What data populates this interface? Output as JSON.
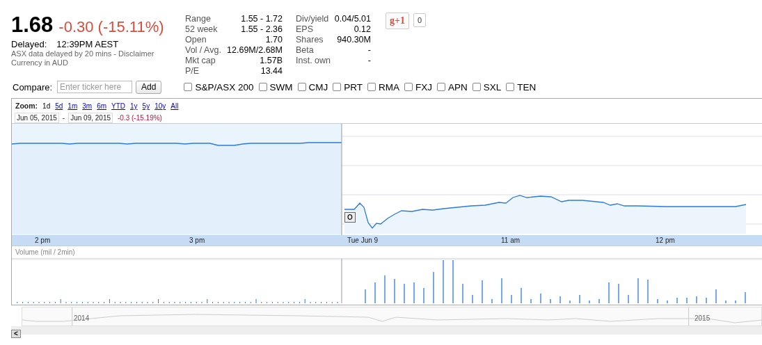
{
  "quote": {
    "price": "1.68",
    "change": "-0.30 (-15.11%)",
    "delayed_label": "Delayed:",
    "time": "12:39PM AEST",
    "notice": "ASX data delayed by 20 mins - Disclaimer",
    "currency": "Currency in AUD"
  },
  "stats": [
    [
      {
        "label": "Range",
        "value": "1.55 - 1.72"
      },
      {
        "label": "52 week",
        "value": "1.55 - 2.36"
      },
      {
        "label": "Open",
        "value": "1.70"
      },
      {
        "label": "Vol / Avg.",
        "value": "12.69M/2.68M"
      },
      {
        "label": "Mkt cap",
        "value": "1.57B"
      },
      {
        "label": "P/E",
        "value": "13.44"
      }
    ],
    [
      {
        "label": "Div/yield",
        "value": "0.04/5.01"
      },
      {
        "label": "EPS",
        "value": "0.12"
      },
      {
        "label": "Shares",
        "value": "940.30M"
      },
      {
        "label": "Beta",
        "value": "-"
      },
      {
        "label": "Inst. own",
        "value": "-"
      }
    ]
  ],
  "plusone": {
    "label": "g+1",
    "count": "0"
  },
  "compare": {
    "label": "Compare:",
    "placeholder": "Enter ticker here",
    "button": "Add",
    "tickers": [
      {
        "label": "S&P/ASX 200",
        "checked": false
      },
      {
        "label": "SWM",
        "checked": false
      },
      {
        "label": "CMJ",
        "checked": false
      },
      {
        "label": "PRT",
        "checked": false
      },
      {
        "label": "RMA",
        "checked": false
      },
      {
        "label": "FXJ",
        "checked": false
      },
      {
        "label": "APN",
        "checked": false
      },
      {
        "label": "SXL",
        "checked": false
      },
      {
        "label": "TEN",
        "checked": false
      }
    ]
  },
  "zoom": {
    "label": "Zoom:",
    "options": [
      {
        "label": "1d",
        "selected": true
      },
      {
        "label": "5d",
        "selected": false
      },
      {
        "label": "1m",
        "selected": false
      },
      {
        "label": "3m",
        "selected": false
      },
      {
        "label": "6m",
        "selected": false
      },
      {
        "label": "YTD",
        "selected": false
      },
      {
        "label": "1y",
        "selected": false
      },
      {
        "label": "5y",
        "selected": false
      },
      {
        "label": "10y",
        "selected": false
      },
      {
        "label": "All",
        "selected": false
      }
    ]
  },
  "range": {
    "from": "Jun 05, 2015",
    "separator": "-",
    "to": "Jun 09, 2015",
    "change": "-0.3 (-15.19%)"
  },
  "x_axis": [
    "2 pm",
    "3 pm",
    "Tue Jun 9",
    "11 am",
    "12 pm"
  ],
  "volume_label": "Volume (mil / 2min)",
  "event_flag": "O",
  "navigator": [
    "2014",
    "2015"
  ],
  "scroll_left": "<"
}
